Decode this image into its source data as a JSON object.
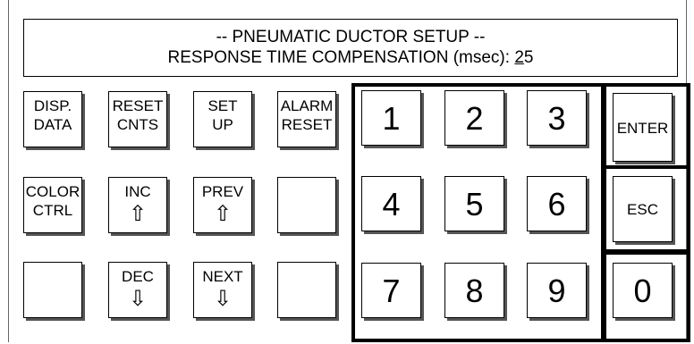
{
  "header": {
    "title": "-- PNEUMATIC DUCTOR SETUP --",
    "subtitle_prefix": "RESPONSE TIME COMPENSATION (msec): ",
    "subtitle_value_first": "2",
    "subtitle_value_rest": "5"
  },
  "function_keys": {
    "disp_data": [
      "DISP.",
      "DATA"
    ],
    "reset_cnts": [
      "RESET",
      "CNTS"
    ],
    "set_up": [
      "SET",
      "UP"
    ],
    "alarm_reset": [
      "ALARM",
      "RESET"
    ],
    "color_ctrl": [
      "COLOR",
      "CTRL"
    ],
    "inc": "INC",
    "prev": "PREV",
    "dec": "DEC",
    "next": "NEXT"
  },
  "icons": {
    "inc": "arrow-up-outline-icon",
    "prev": "arrow-up-outline-icon",
    "dec": "arrow-down-outline-icon",
    "next": "arrow-down-outline-icon"
  },
  "keypad": [
    "1",
    "2",
    "3",
    "4",
    "5",
    "6",
    "7",
    "8",
    "9",
    "0"
  ],
  "enter_label": "ENTER",
  "esc_label": "ESC"
}
